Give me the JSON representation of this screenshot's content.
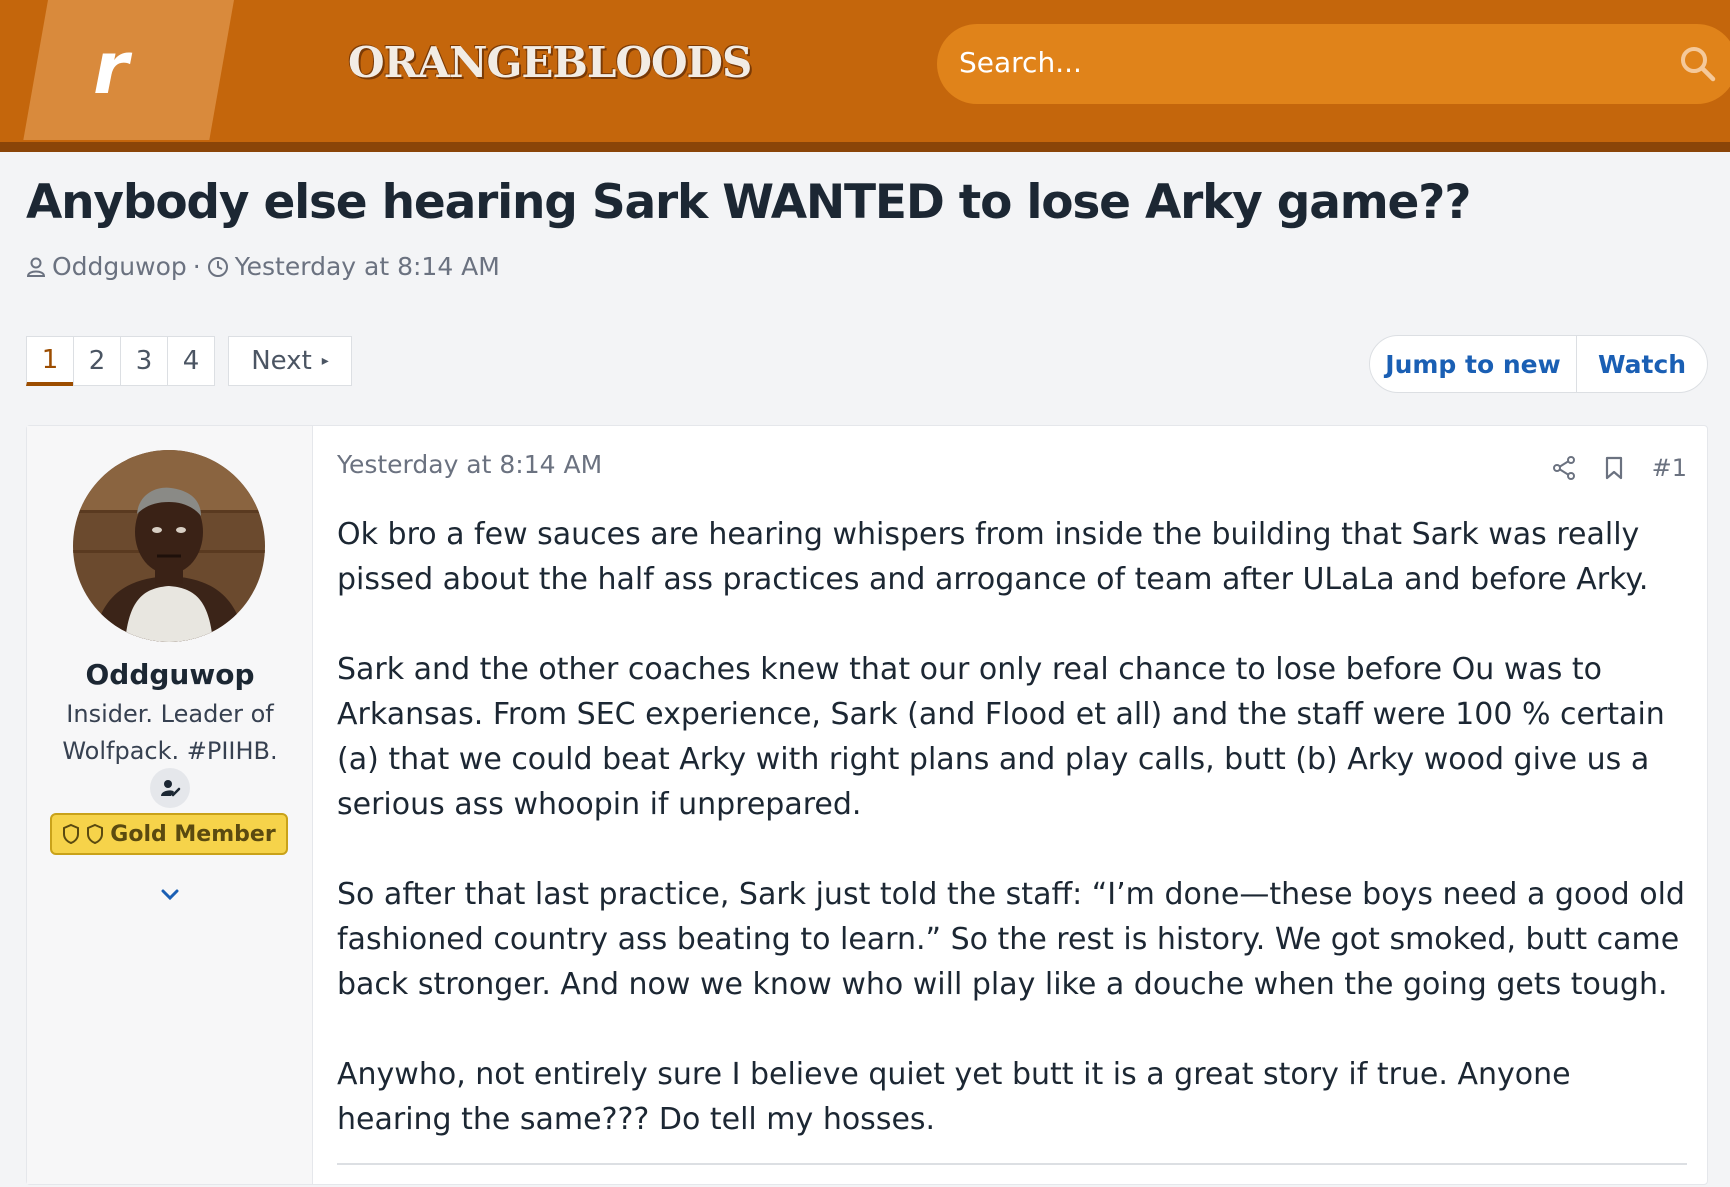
{
  "site": {
    "logo_letter": "r",
    "name": "ORANGEBLOODS",
    "search_placeholder": "Search..."
  },
  "thread": {
    "title": "Anybody else hearing Sark WANTED to lose Arky game??",
    "author": "Oddguwop",
    "separator": "·",
    "posted": "Yesterday at 8:14 AM"
  },
  "pagination": {
    "pages": [
      "1",
      "2",
      "3",
      "4"
    ],
    "current": "1",
    "next_label": "Next"
  },
  "thread_actions": {
    "jump_label": "Jump to new",
    "watch_label": "Watch"
  },
  "post": {
    "username": "Oddguwop",
    "user_title": "Insider. Leader of Wolfpack. #PIIHB.",
    "badge": "Gold Member",
    "date": "Yesterday at 8:14 AM",
    "number": "#1",
    "paragraphs": [
      "Ok bro a few sauces are hearing whispers from inside the building that Sark was really pissed about the half ass practices and arrogance of team after ULaLa and before Arky.",
      "Sark and the other coaches knew that our only real chance to lose before Ou was to Arkansas. From SEC experience, Sark (and Flood et all) and the staff were 100 % certain (a) that we could beat Arky with right plans and play calls, butt (b) Arky wood give us a serious ass whoopin if unprepared.",
      "So after that last practice, Sark just told the staff: “I’m done—these boys need a good old fashioned country ass beating to learn.” So the rest is history. We got smoked, butt came back stronger. And now we know who will play like a douche when the going gets tough.",
      "Anywho, not entirely sure I believe quiet yet butt it is a great story if true. Anyone hearing the same??? Do tell my hosses."
    ]
  },
  "colors": {
    "header_bg": "#c4660c",
    "header_border": "#8a4508",
    "search_bg": "#e0831a",
    "link_blue": "#1a5fb4",
    "page_accent": "#9c4d00",
    "gold_badge": "#f6d34a"
  },
  "icons": {
    "search": "search-icon",
    "user": "user-icon",
    "clock": "clock-icon",
    "share": "share-icon",
    "bookmark": "bookmark-icon",
    "chevron": "chevron-down-icon",
    "shield": "shield-icon",
    "user_edit": "user-edit-icon"
  }
}
